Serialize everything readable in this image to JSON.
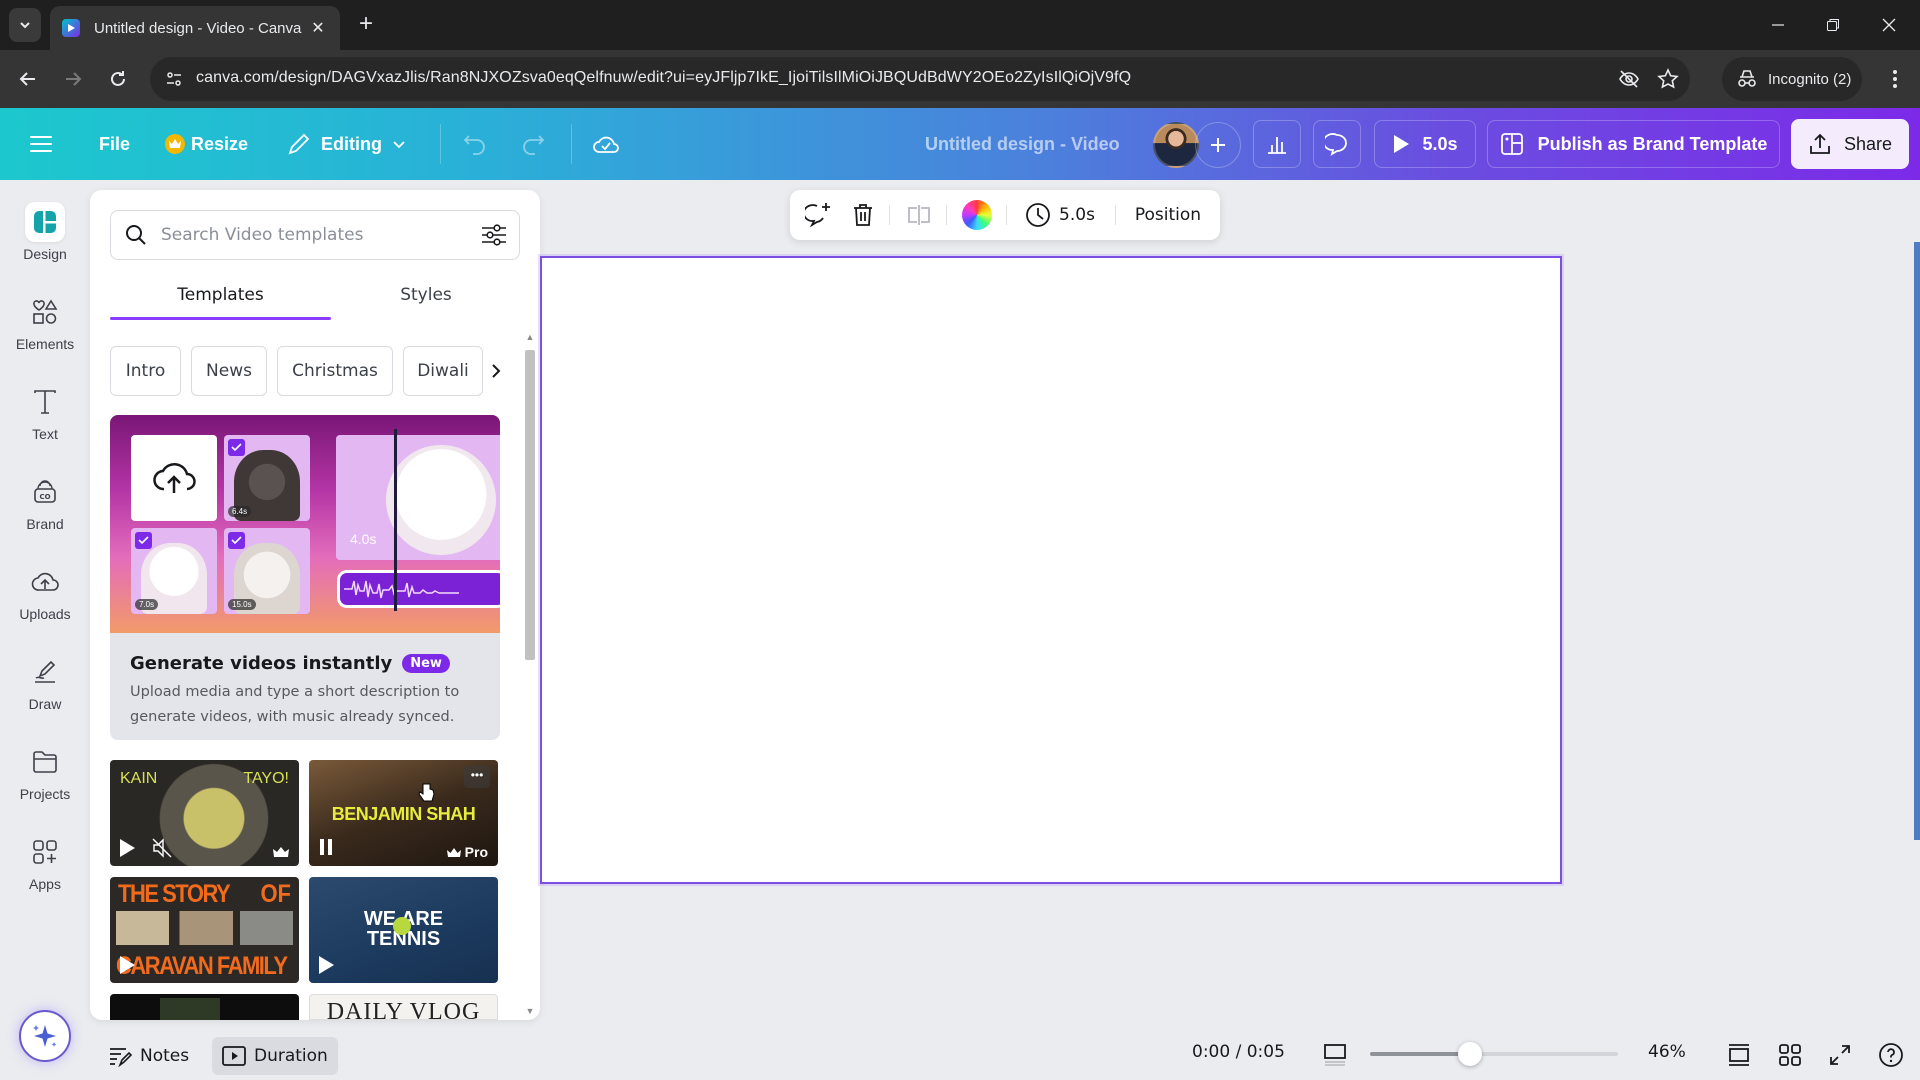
{
  "browser": {
    "tab_title": "Untitled design - Video - Canva",
    "url": "canva.com/design/DAGVxazJlis/Ran8NJXOZsva0eqQelfnuw/edit?ui=eyJFljp7IkE_IjoiTilsIlMiOiJBQUdBdWY2OEo2ZyIsIlQiOjV9fQ",
    "incognito_label": "Incognito (2)"
  },
  "topbar": {
    "file": "File",
    "resize": "Resize",
    "editing": "Editing",
    "design_title": "Untitled design - Video",
    "play_duration": "5.0s",
    "publish": "Publish as Brand Template",
    "share": "Share"
  },
  "rail": {
    "items": [
      {
        "label": "Design"
      },
      {
        "label": "Elements"
      },
      {
        "label": "Text"
      },
      {
        "label": "Brand"
      },
      {
        "label": "Uploads"
      },
      {
        "label": "Draw"
      },
      {
        "label": "Projects"
      },
      {
        "label": "Apps"
      }
    ]
  },
  "panel": {
    "search_placeholder": "Search Video templates",
    "tabs": [
      {
        "label": "Templates"
      },
      {
        "label": "Styles"
      }
    ],
    "chips": [
      {
        "label": "Intro"
      },
      {
        "label": "News"
      },
      {
        "label": "Christmas"
      },
      {
        "label": "Diwali"
      }
    ],
    "promo": {
      "title": "Generate videos instantly",
      "badge": "New",
      "description": "Upload media and type a short description to generate videos, with music already synced.",
      "clip_durations": [
        "6.4s",
        "7.0s",
        "15.0s",
        "4.0s"
      ]
    },
    "templates": [
      {
        "text_left": "KAIN",
        "text_right": "TAYO!"
      },
      {
        "text": "BENJAMIN SHAH",
        "badge": "Pro"
      },
      {
        "text_top": "THE STORY",
        "text_of": "OF",
        "text_bottom": "CARAVAN FAMILY"
      },
      {
        "text_top": "WE ARE",
        "text_bottom": "TENNIS"
      },
      {
        "text": ""
      },
      {
        "text": "DAILY VLOG"
      }
    ]
  },
  "float_toolbar": {
    "duration": "5.0s",
    "position": "Position"
  },
  "bottombar": {
    "notes": "Notes",
    "duration": "Duration",
    "timecode": "0:00 / 0:05",
    "zoom_percent": "46%",
    "zoom_value": 46
  },
  "colors": {
    "accent": "#7d2ae8",
    "page_border": "#7d4ee0"
  }
}
